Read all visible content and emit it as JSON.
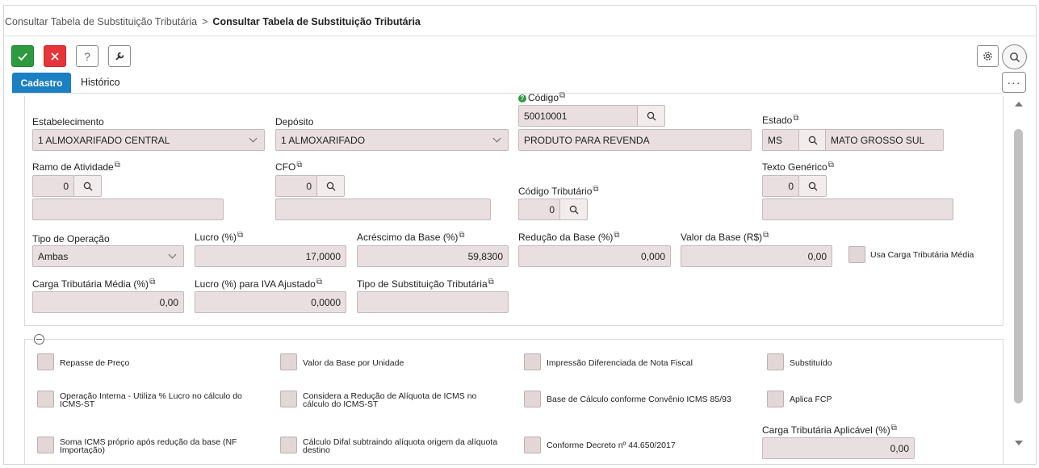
{
  "breadcrumb": {
    "parent": "Consultar Tabela de Substituição Tributária",
    "separator": ">",
    "current": "Consultar Tabela de Substituição Tributária"
  },
  "toolbar": {
    "confirm_icon": "check-icon",
    "cancel_icon": "close-icon",
    "help_label": "?",
    "tool_icon": "wrench-icon",
    "more_label": "···"
  },
  "tabs": [
    {
      "label": "Cadastro",
      "active": true
    },
    {
      "label": "Histórico",
      "active": false
    }
  ],
  "form": {
    "estabelecimento": {
      "label": "Estabelecimento",
      "value": "1 ALMOXARIFADO CENTRAL"
    },
    "deposito": {
      "label": "Depósito",
      "value": "1 ALMOXARIFADO"
    },
    "codigo": {
      "label": "Código",
      "value": "50010001",
      "description": "PRODUTO PARA REVENDA"
    },
    "estado": {
      "label": "Estado",
      "code": "MS",
      "name": "MATO GROSSO SUL"
    },
    "ramo_atividade": {
      "label": "Ramo de Atividade",
      "value": "0",
      "description": ""
    },
    "cfo": {
      "label": "CFO",
      "value": "0",
      "description": ""
    },
    "codigo_tributario": {
      "label": "Código Tributário",
      "value": "0"
    },
    "texto_generico": {
      "label": "Texto Genérico",
      "value": "0",
      "description": ""
    },
    "tipo_operacao": {
      "label": "Tipo de Operação",
      "value": "Ambas"
    },
    "lucro": {
      "label": "Lucro (%)",
      "value": "17,0000"
    },
    "acrescimo_base": {
      "label": "Acréscimo da Base (%)",
      "value": "59,8300"
    },
    "reducao_base": {
      "label": "Redução da Base (%)",
      "value": "0,000"
    },
    "valor_base": {
      "label": "Valor da Base (R$)",
      "value": "0,00"
    },
    "usa_carga": {
      "label": "Usa Carga Tributária Média",
      "checked": false
    },
    "carga_media": {
      "label": "Carga Tributária Média (%)",
      "value": "0,00"
    },
    "lucro_iva": {
      "label": "Lucro (%) para IVA Ajustado",
      "value": "0,0000"
    },
    "tipo_substituicao": {
      "label": "Tipo de Substituição Tributária",
      "value": ""
    }
  },
  "options": {
    "repasse_preco": "Repasse de Preço",
    "valor_base_unidade": "Valor da Base por Unidade",
    "impressao_diferenciada": "Impressão Diferenciada de Nota Fiscal",
    "substituido": "Substituído",
    "operacao_interna": "Operação Interna - Utiliza % Lucro no cálculo do ICMS-ST",
    "considera_reducao": "Considera a Redução de Alíquota de ICMS no cálculo do ICMS-ST",
    "base_calculo_convenio": "Base de Cálculo conforme Convênio ICMS 85/93",
    "aplica_fcp": "Aplica FCP",
    "soma_icms": "Soma ICMS próprio após redução da base (NF Importação)",
    "calculo_difal": "Cálculo Difal subtraindo alíquota origem da alíquota destino",
    "conforme_decreto": "Conforme Decreto nº 44.650/2017",
    "carga_aplicavel": {
      "label": "Carga Tributária Aplicável (%)",
      "value": "0,00"
    }
  },
  "colors": {
    "accent": "#1b7fc4",
    "confirm": "#2d9a3f",
    "cancel": "#e5353a",
    "field_bg": "#e9dfe0"
  }
}
